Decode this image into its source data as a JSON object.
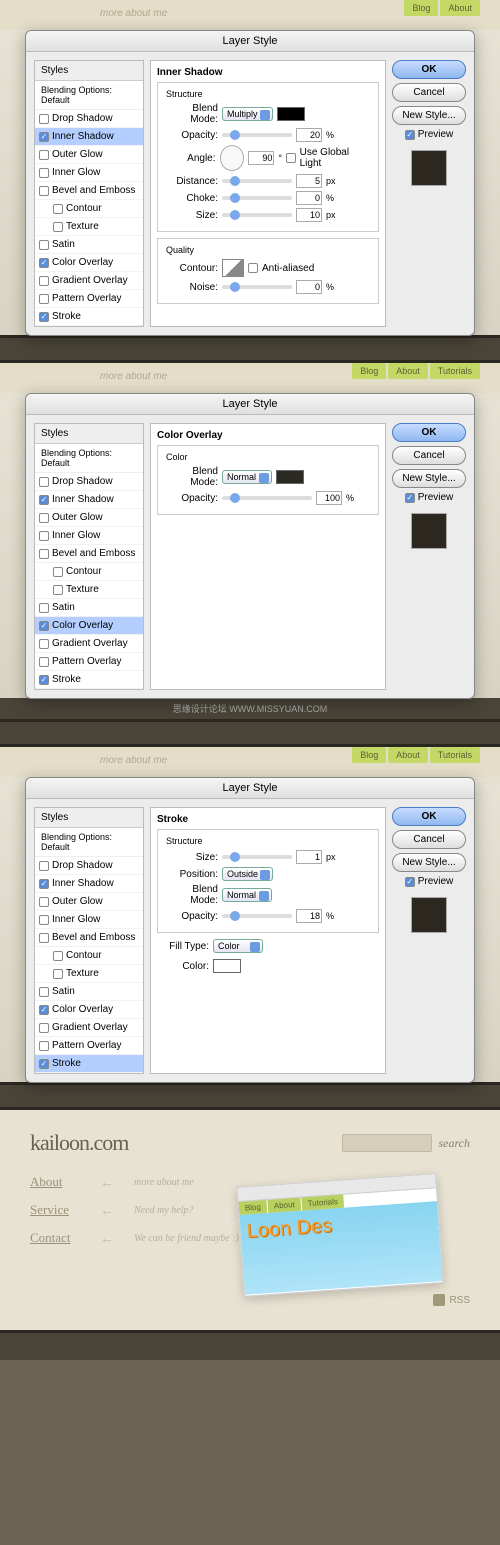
{
  "header": {
    "more_about": "more about me"
  },
  "nav_pills": [
    "Blog",
    "About",
    "Tutorials"
  ],
  "dialog_title": "Layer Style",
  "styles": {
    "header": "Styles",
    "blending": "Blending Options: Default",
    "items": [
      {
        "label": "Drop Shadow",
        "checked": false
      },
      {
        "label": "Inner Shadow",
        "checked": true
      },
      {
        "label": "Outer Glow",
        "checked": false
      },
      {
        "label": "Inner Glow",
        "checked": false
      },
      {
        "label": "Bevel and Emboss",
        "checked": false
      },
      {
        "label": "Contour",
        "checked": false,
        "indent": true
      },
      {
        "label": "Texture",
        "checked": false,
        "indent": true
      },
      {
        "label": "Satin",
        "checked": false
      },
      {
        "label": "Color Overlay",
        "checked": true
      },
      {
        "label": "Gradient Overlay",
        "checked": false
      },
      {
        "label": "Pattern Overlay",
        "checked": false
      },
      {
        "label": "Stroke",
        "checked": true
      }
    ]
  },
  "buttons": {
    "ok": "OK",
    "cancel": "Cancel",
    "new_style": "New Style...",
    "preview": "Preview"
  },
  "panel1": {
    "title": "Inner Shadow",
    "structure": "Structure",
    "blend_label": "Blend Mode:",
    "blend_val": "Multiply",
    "opacity_label": "Opacity:",
    "opacity_val": "20",
    "pct": "%",
    "angle_label": "Angle:",
    "angle_val": "90",
    "deg": "°",
    "global": "Use Global Light",
    "distance_label": "Distance:",
    "distance_val": "5",
    "px": "px",
    "choke_label": "Choke:",
    "choke_val": "0",
    "size_label": "Size:",
    "size_val": "10",
    "quality": "Quality",
    "contour_label": "Contour:",
    "antialiased": "Anti-aliased",
    "noise_label": "Noise:",
    "noise_val": "0"
  },
  "panel2": {
    "title": "Color Overlay",
    "color": "Color",
    "blend_label": "Blend Mode:",
    "blend_val": "Normal",
    "opacity_label": "Opacity:",
    "opacity_val": "100",
    "pct": "%"
  },
  "panel3": {
    "title": "Stroke",
    "structure": "Structure",
    "size_label": "Size:",
    "size_val": "1",
    "px": "px",
    "position_label": "Position:",
    "position_val": "Outside",
    "blend_label": "Blend Mode:",
    "blend_val": "Normal",
    "opacity_label": "Opacity:",
    "opacity_val": "18",
    "pct": "%",
    "filltype_label": "Fill Type:",
    "filltype_val": "Color",
    "color_label": "Color:"
  },
  "watermark": "思缘设计论坛  WWW.MISSYUAN.COM",
  "site": {
    "logo": "kailoon.com",
    "search": "search",
    "links": [
      {
        "main": "About",
        "sub": "more about me"
      },
      {
        "main": "Service",
        "sub": "Need my help?"
      },
      {
        "main": "Contact",
        "sub": "We can be friend maybe :)"
      }
    ],
    "rss": "RSS",
    "mock_nav": [
      "Blog",
      "About",
      "Tutorials"
    ],
    "mock_logo": "Loon Des"
  }
}
